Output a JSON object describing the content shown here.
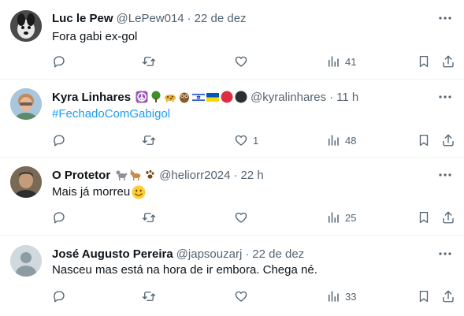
{
  "tweets": [
    {
      "name": "Luc le Pew",
      "handle": "@LePew014",
      "time": "22 de dez",
      "text": "Fora gabi ex-gol",
      "text_is_link": false,
      "likes": "",
      "views": "41"
    },
    {
      "name": "Kyra Linhares",
      "handle": "@kyralinhares",
      "time": "11 h",
      "text": "#FechadoComGabigol",
      "text_is_link": true,
      "likes": "1",
      "views": "48"
    },
    {
      "name": "O Protetor",
      "handle": "@heliorr2024",
      "time": "22 h",
      "text": "Mais já morreu",
      "text_is_link": false,
      "likes": "",
      "views": "25"
    },
    {
      "name": "José Augusto Pereira",
      "handle": "@japsouzarj",
      "time": "22 de dez",
      "text": "Nasceu mas está na hora de ir embora. Chega né.",
      "text_is_link": false,
      "likes": "",
      "views": "33"
    }
  ],
  "separator": "·",
  "colors": {
    "text": "#0f1419",
    "secondary": "#536471",
    "link": "#1d9bf0",
    "divider": "#eff3f4"
  },
  "icons": [
    "reply-icon",
    "retweet-icon",
    "like-icon",
    "views-icon",
    "bookmark-icon",
    "share-icon",
    "more-icon"
  ]
}
